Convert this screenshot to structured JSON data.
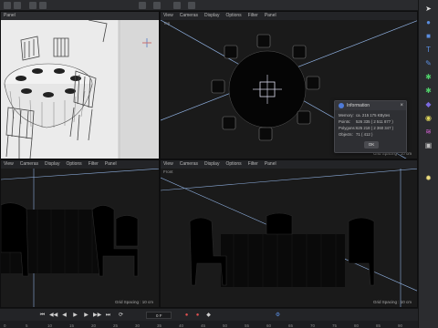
{
  "top_toolbar": {
    "icons": [
      "select-tool-icon",
      "move-tool-icon",
      "scale-tool-icon",
      "rotate-tool-icon",
      "render-icon",
      "render-settings-icon",
      "cube-icon",
      "spline-icon"
    ]
  },
  "viewport_perspective": {
    "menu": [
      "Panel"
    ],
    "name": "",
    "grid_label": ""
  },
  "viewport_top": {
    "menu": [
      "View",
      "Cameras",
      "Display",
      "Options",
      "Filter",
      "Panel"
    ],
    "name": "Top",
    "grid_label": "Grid Spacing : 10 cm"
  },
  "viewport_right": {
    "menu": [
      "View",
      "Cameras",
      "Display",
      "Options",
      "Filter",
      "Panel"
    ],
    "name": "",
    "grid_label": "Grid Spacing : 10 cm"
  },
  "viewport_front": {
    "menu": [
      "View",
      "Cameras",
      "Display",
      "Options",
      "Filter",
      "Panel"
    ],
    "name": "Front",
    "grid_label": "Grid Spacing : 10 cm"
  },
  "info_dialog": {
    "title": "Information",
    "close": "×",
    "rows": [
      {
        "label": "Memory:",
        "value": "ca. 215 175 KBytes"
      },
      {
        "label": "Points:",
        "value": "526 335 ( 2 511 877 )"
      },
      {
        "label": "Polygons:",
        "value": "625 218 ( 2 360 347 )"
      },
      {
        "label": "Objects:",
        "value": "71 ( 412 )"
      }
    ],
    "ok_label": "OK"
  },
  "timeline": {
    "frame": "0 F",
    "ticks": [
      "0",
      "5",
      "10",
      "15",
      "20",
      "25",
      "30",
      "35",
      "40",
      "45",
      "50",
      "55",
      "60",
      "65",
      "70",
      "75",
      "80",
      "85",
      "90"
    ]
  },
  "right_toolbar": {
    "icons": [
      "cursor-icon",
      "sphere-icon",
      "cube-icon",
      "text-icon",
      "spline-pen-icon",
      "cloner-icon",
      "deformer-icon",
      "camera-icon",
      "material-icon",
      "hair-icon",
      "scene-icon",
      "light-icon"
    ]
  },
  "colors": {
    "viewport_bg": "#1a1a1a",
    "toolbar_bg": "#2b2c2f",
    "accent": "#4f7bd8"
  }
}
